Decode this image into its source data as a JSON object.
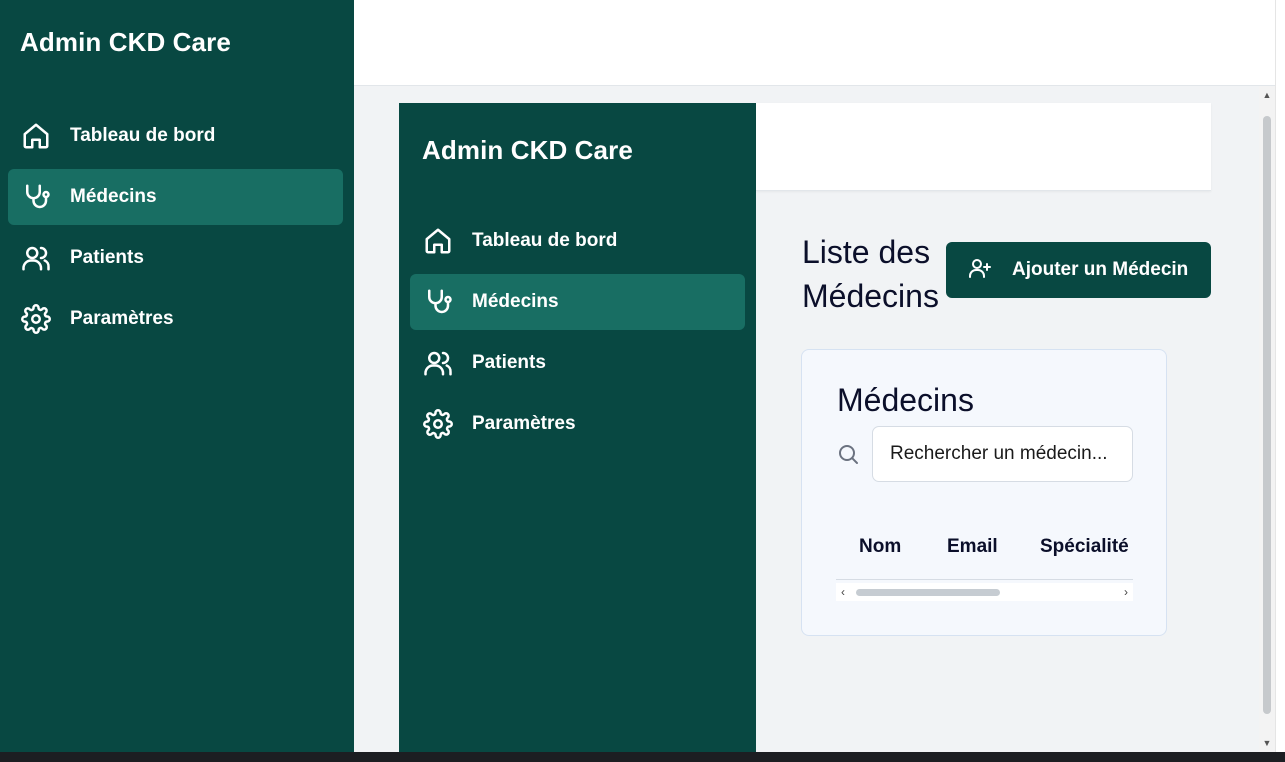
{
  "app": {
    "brand": "Admin CKD Care"
  },
  "nav": {
    "items": [
      {
        "label": "Tableau de bord",
        "icon": "home-icon",
        "active": false
      },
      {
        "label": "Médecins",
        "icon": "stethoscope-icon",
        "active": true
      },
      {
        "label": "Patients",
        "icon": "users-icon",
        "active": false
      },
      {
        "label": "Paramètres",
        "icon": "gear-icon",
        "active": false
      }
    ]
  },
  "main": {
    "page_title": "Liste des Médecins",
    "add_button_label": "Ajouter un Médecin",
    "add_button_icon": "user-plus-icon"
  },
  "card": {
    "title": "Médecins",
    "search_placeholder": "Rechercher un médecin...",
    "search_value": "",
    "columns": [
      "Nom",
      "Email",
      "Spécialité"
    ]
  },
  "colors": {
    "sidebar_bg": "#084842",
    "sidebar_active": "#186e63",
    "accent": "#084842",
    "page_bg": "#f1f3f5",
    "card_bg": "#f5f8fd"
  }
}
